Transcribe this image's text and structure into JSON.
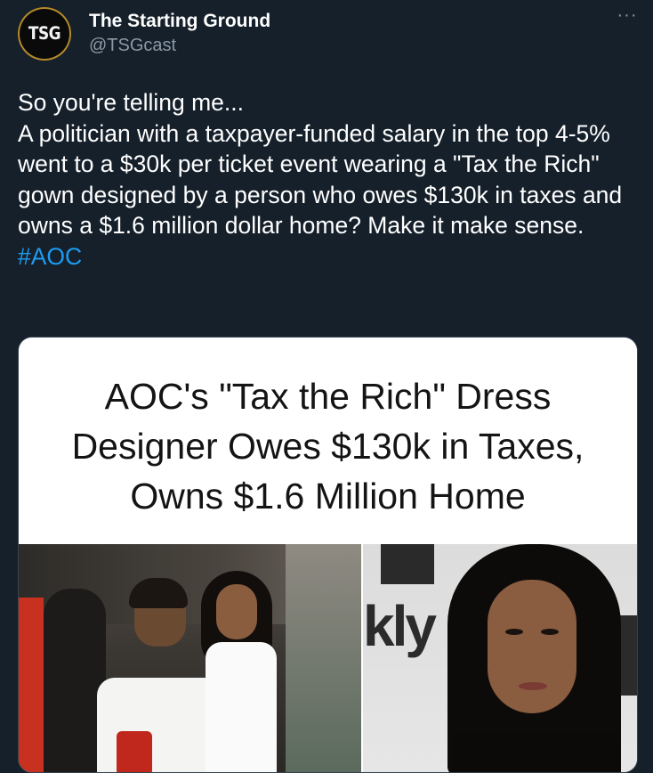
{
  "account": {
    "avatar_text": "TSG",
    "display_name": "The Starting Ground",
    "handle": "@TSGcast"
  },
  "tweet": {
    "text": "So you're telling me...\nA politician with a taxpayer-funded salary in the top 4-5% went to a $30k per ticket event wearing a \"Tax the Rich\" gown designed by a person who owes $130k in taxes and owns a $1.6 million dollar home? Make it make sense.",
    "hashtag": "#AOC"
  },
  "media": {
    "headline_line1": "AOC's \"Tax the Rich\" Dress",
    "headline_line2": "Designer Owes $130k in Taxes,",
    "headline_line3": "Owns $1.6 Million Home",
    "backdrop_text": "kly"
  },
  "colors": {
    "background": "#15202b",
    "link": "#1d9bf0",
    "secondary_text": "#8b98a5"
  }
}
